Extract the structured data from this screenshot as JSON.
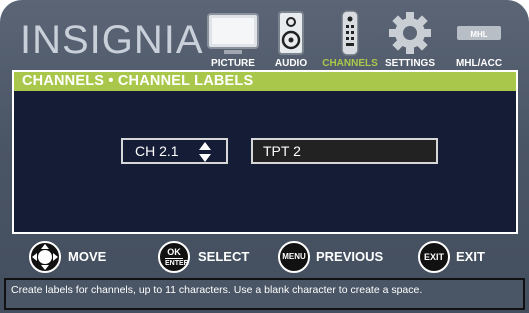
{
  "brand": {
    "logo": "INSIGNIA",
    "accent": "#a9c84b"
  },
  "top_menu": [
    {
      "label": "PICTURE",
      "icon": "tv-icon",
      "active": false
    },
    {
      "label": "AUDIO",
      "icon": "speaker-icon",
      "active": false
    },
    {
      "label": "CHANNELS",
      "icon": "remote-icon",
      "active": true
    },
    {
      "label": "SETTINGS",
      "icon": "gear-icon",
      "active": false
    },
    {
      "label": "MHL/ACC",
      "icon": "mhl-icon",
      "active": false,
      "badge": "MHL"
    }
  ],
  "panel": {
    "title": "CHANNELS • CHANNEL LABELS"
  },
  "channel": {
    "value": "CH 2.1",
    "label_value": "TPT 2"
  },
  "hints": [
    {
      "button": "",
      "label": "MOVE"
    },
    {
      "button_top": "OK",
      "button_bottom": "ENTER",
      "label": "SELECT"
    },
    {
      "button": "MENU",
      "label": "PREVIOUS"
    },
    {
      "button": "EXIT",
      "label": "EXIT"
    }
  ],
  "status": "Create labels for channels, up to 11 characters. Use a blank character to create a space."
}
